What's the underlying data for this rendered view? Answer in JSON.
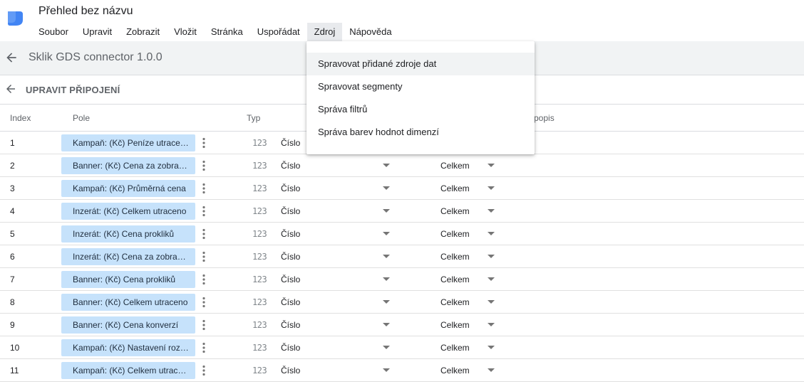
{
  "app": {
    "document_title": "Přehled bez názvu",
    "menu": [
      "Soubor",
      "Upravit",
      "Zobrazit",
      "Vložit",
      "Stránka",
      "Uspořádat",
      "Zdroj",
      "Nápověda"
    ],
    "active_menu": "Zdroj",
    "accent_color": "#4285f4"
  },
  "source_bar": {
    "name": "Sklik GDS connector 1.0.0",
    "back_icon": "arrow-left-icon"
  },
  "edit_bar": {
    "label": "UPRAVIT PŘIPOJENÍ",
    "back_icon": "arrow-left-icon"
  },
  "table": {
    "headers": {
      "index": "Index",
      "field": "Pole",
      "type": "Typ",
      "description": "popis"
    },
    "rows": [
      {
        "index": "1",
        "field": "Kampaň: (Kč) Peníze utraceno",
        "type_icon": "123",
        "type": "Číslo",
        "aggregation": ""
      },
      {
        "index": "2",
        "field": "Banner: (Kč) Cena za zobrazení",
        "type_icon": "123",
        "type": "Číslo",
        "aggregation": "Celkem"
      },
      {
        "index": "3",
        "field": "Kampaň: (Kč) Průměrná cena",
        "type_icon": "123",
        "type": "Číslo",
        "aggregation": "Celkem"
      },
      {
        "index": "4",
        "field": "Inzerát: (Kč) Celkem utraceno",
        "type_icon": "123",
        "type": "Číslo",
        "aggregation": "Celkem"
      },
      {
        "index": "5",
        "field": "Inzerát: (Kč) Cena prokliků",
        "type_icon": "123",
        "type": "Číslo",
        "aggregation": "Celkem"
      },
      {
        "index": "6",
        "field": "Inzerát: (Kč) Cena za zobrazení",
        "type_icon": "123",
        "type": "Číslo",
        "aggregation": "Celkem"
      },
      {
        "index": "7",
        "field": "Banner: (Kč) Cena prokliků",
        "type_icon": "123",
        "type": "Číslo",
        "aggregation": "Celkem"
      },
      {
        "index": "8",
        "field": "Banner: (Kč) Celkem utraceno",
        "type_icon": "123",
        "type": "Číslo",
        "aggregation": "Celkem"
      },
      {
        "index": "9",
        "field": "Banner: (Kč) Cena konverzí",
        "type_icon": "123",
        "type": "Číslo",
        "aggregation": "Celkem"
      },
      {
        "index": "10",
        "field": "Kampaň: (Kč) Nastavení rozpočtu",
        "type_icon": "123",
        "type": "Číslo",
        "aggregation": "Celkem"
      },
      {
        "index": "11",
        "field": "Kampaň: (Kč) Celkem utraceno",
        "type_icon": "123",
        "type": "Číslo",
        "aggregation": "Celkem"
      }
    ]
  },
  "dropdown_menu": {
    "items": [
      "Spravovat přidané zdroje dat",
      "Spravovat segmenty",
      "Správa filtrů",
      "Správa barev hodnot dimenzí"
    ],
    "hovered_index": 0
  }
}
